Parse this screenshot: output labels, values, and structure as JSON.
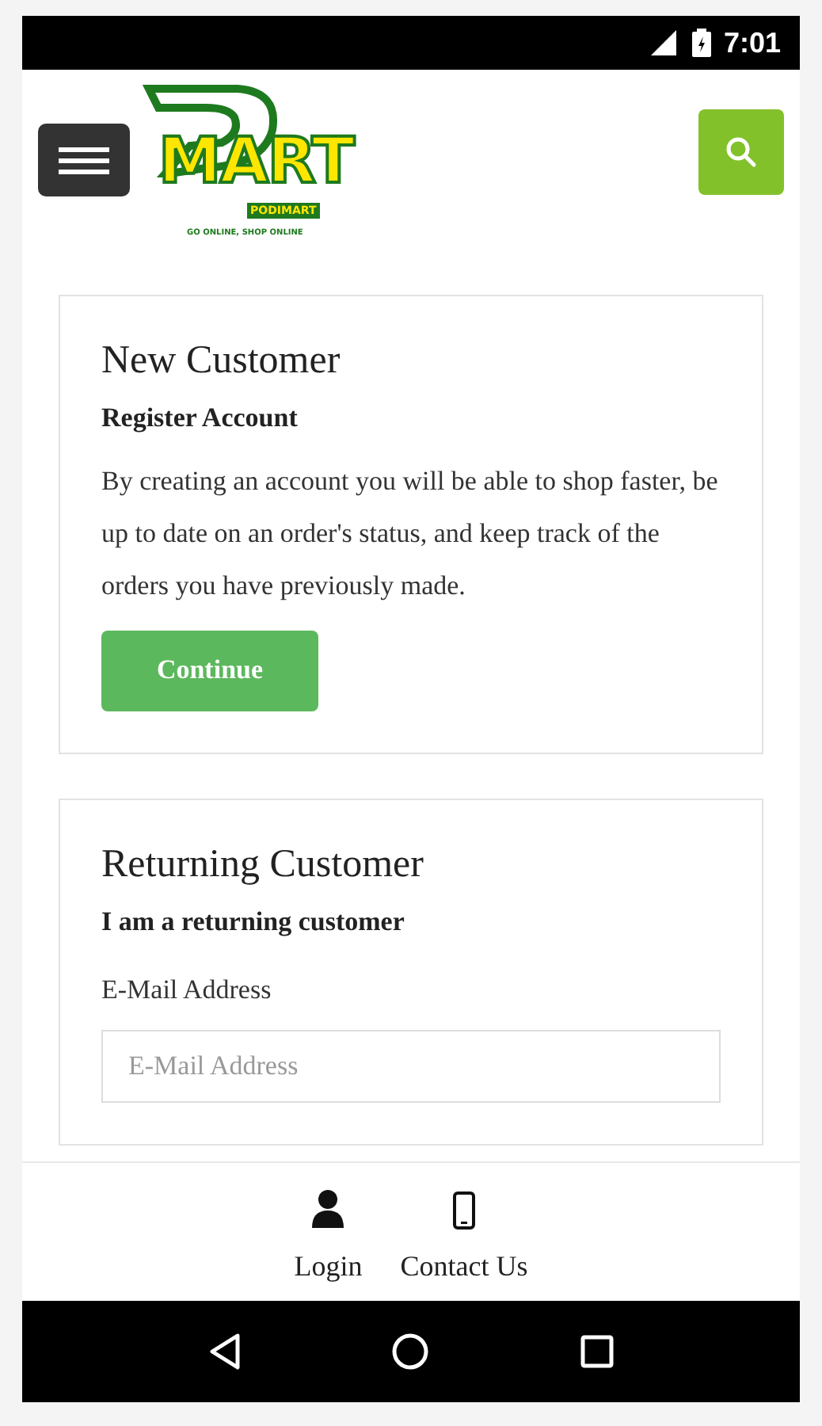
{
  "status_bar": {
    "time": "7:01"
  },
  "header": {
    "logo": {
      "wordmark": "MART",
      "brand": "PODIMART",
      "tagline": "GO ONLINE, SHOP ONLINE"
    }
  },
  "new_customer": {
    "title": "New Customer",
    "subtitle": "Register Account",
    "text": "By creating an account you will be able to shop faster, be up to date on an order's status, and keep track of the orders you have previously made.",
    "button": "Continue"
  },
  "returning_customer": {
    "title": "Returning Customer",
    "subtitle": "I am a returning customer",
    "email_label": "E-Mail Address",
    "email_field": {
      "placeholder": "E-Mail Address"
    }
  },
  "bottom_nav": [
    {
      "kind": "user",
      "label": "Login"
    },
    {
      "kind": "phone",
      "label": "Contact Us"
    }
  ]
}
